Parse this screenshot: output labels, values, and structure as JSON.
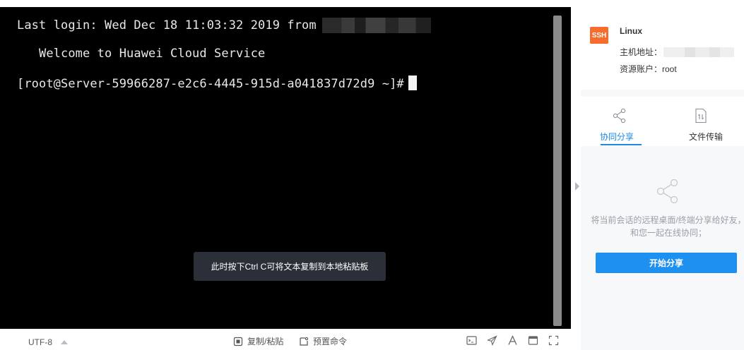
{
  "terminal": {
    "login_text": "Last login: Wed Dec 18 11:03:32 2019 from",
    "welcome_text": "   Welcome to Huawei Cloud Service",
    "prompt_text": "[root@Server-59966287-e2c6-4445-915d-a041837d72d9 ~]#",
    "toast_text": "此时按下Ctrl C可将文本复制到本地粘贴板"
  },
  "bottom_bar": {
    "encoding": "UTF-8",
    "copy_paste_label": "复制/粘贴",
    "preset_command_label": "预置命令",
    "icons": [
      "terminal-icon",
      "send-icon",
      "font-icon",
      "window-icon",
      "fullscreen-icon"
    ]
  },
  "side_panel": {
    "badge": "SSH",
    "os_name": "Linux",
    "host_address_label": "主机地址：",
    "account_text": "资源账户：root",
    "tabs": [
      {
        "label": "协同分享",
        "icon": "share-icon",
        "active": true
      },
      {
        "label": "文件传输",
        "icon": "file-transfer-icon",
        "active": false
      }
    ],
    "share_description": "将当前会话的远程桌面/终端分享给好友，和您一起在线协同；",
    "start_share_label": "开始分享"
  },
  "colors": {
    "accent": "#1e88e5",
    "badge": "#f56c2d",
    "terminal_bg": "#000000",
    "toast_bg": "#2b2f38"
  }
}
